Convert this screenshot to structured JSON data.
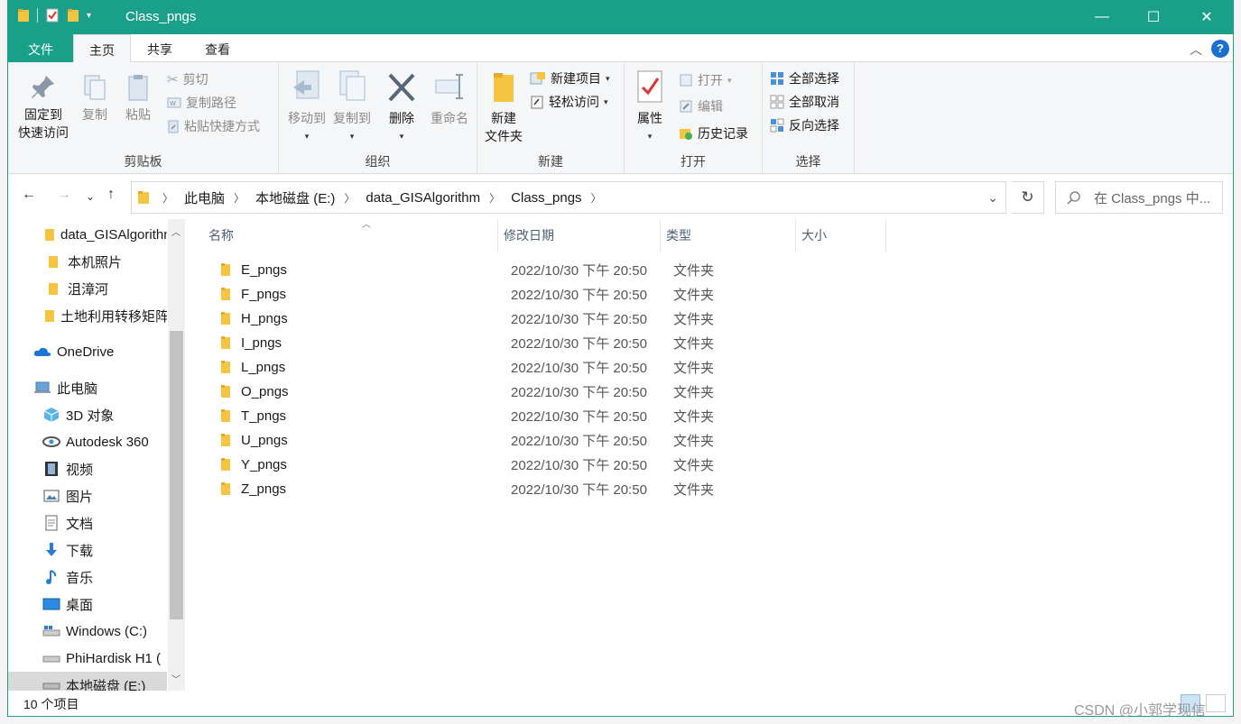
{
  "window": {
    "title": "Class_pngs",
    "minimize": "—",
    "maximize": "☐",
    "close": "✕"
  },
  "tabs": [
    {
      "label": "文件"
    },
    {
      "label": "主页"
    },
    {
      "label": "共享"
    },
    {
      "label": "查看"
    }
  ],
  "ribbon": {
    "clipboard": {
      "label": "剪贴板",
      "pin": "固定到",
      "pin2": "快速访问",
      "copy": "复制",
      "paste": "粘贴",
      "cut": "剪切",
      "copy_path": "复制路径",
      "paste_shortcut": "粘贴快捷方式"
    },
    "organize": {
      "label": "组织",
      "move_to": "移动到",
      "copy_to": "复制到",
      "delete": "删除",
      "rename": "重命名"
    },
    "new": {
      "label": "新建",
      "new_folder": "新建",
      "new_folder2": "文件夹",
      "new_item": "新建项目",
      "easy_access": "轻松访问"
    },
    "open": {
      "label": "打开",
      "properties": "属性",
      "open": "打开",
      "edit": "编辑",
      "history": "历史记录"
    },
    "select": {
      "label": "选择",
      "select_all": "全部选择",
      "select_none": "全部取消",
      "invert": "反向选择"
    }
  },
  "address": {
    "crumbs": [
      "此电脑",
      "本地磁盘 (E:)",
      "data_GISAlgorithm",
      "Class_pngs"
    ],
    "search_placeholder": "在 Class_pngs 中..."
  },
  "nav": [
    {
      "label": "data_GISAlgorithm",
      "icon": "folder-icon"
    },
    {
      "label": "本机照片",
      "icon": "folder-icon"
    },
    {
      "label": "沮漳河",
      "icon": "folder-icon"
    },
    {
      "label": "土地利用转移矩阵",
      "icon": "folder-icon"
    },
    {
      "label": "OneDrive",
      "icon": "cloud-icon"
    },
    {
      "label": "此电脑",
      "icon": "computer-icon"
    },
    {
      "label": "3D 对象",
      "icon": "cube-icon"
    },
    {
      "label": "Autodesk 360",
      "icon": "autodesk-icon"
    },
    {
      "label": "视频",
      "icon": "video-icon"
    },
    {
      "label": "图片",
      "icon": "picture-icon"
    },
    {
      "label": "文档",
      "icon": "document-icon"
    },
    {
      "label": "下载",
      "icon": "download-icon"
    },
    {
      "label": "音乐",
      "icon": "music-icon"
    },
    {
      "label": "桌面",
      "icon": "desktop-icon"
    },
    {
      "label": "Windows (C:)",
      "icon": "drive-icon"
    },
    {
      "label": "PhiHardisk H1 (",
      "icon": "drive-icon"
    },
    {
      "label": "本地磁盘 (E:)",
      "icon": "drive-icon"
    }
  ],
  "columns": {
    "name": "名称",
    "date": "修改日期",
    "type": "类型",
    "size": "大小"
  },
  "files": [
    {
      "name": "E_pngs",
      "date": "2022/10/30 下午 20:50",
      "type": "文件夹"
    },
    {
      "name": "F_pngs",
      "date": "2022/10/30 下午 20:50",
      "type": "文件夹"
    },
    {
      "name": "H_pngs",
      "date": "2022/10/30 下午 20:50",
      "type": "文件夹"
    },
    {
      "name": "I_pngs",
      "date": "2022/10/30 下午 20:50",
      "type": "文件夹"
    },
    {
      "name": "L_pngs",
      "date": "2022/10/30 下午 20:50",
      "type": "文件夹"
    },
    {
      "name": "O_pngs",
      "date": "2022/10/30 下午 20:50",
      "type": "文件夹"
    },
    {
      "name": "T_pngs",
      "date": "2022/10/30 下午 20:50",
      "type": "文件夹"
    },
    {
      "name": "U_pngs",
      "date": "2022/10/30 下午 20:50",
      "type": "文件夹"
    },
    {
      "name": "Y_pngs",
      "date": "2022/10/30 下午 20:50",
      "type": "文件夹"
    },
    {
      "name": "Z_pngs",
      "date": "2022/10/30 下午 20:50",
      "type": "文件夹"
    }
  ],
  "status": {
    "count": "10 个项目"
  },
  "watermark": "CSDN @小郭学现信",
  "colors": {
    "accent": "#1aa08a",
    "folder": "#f5c542",
    "help": "#1a6fd0"
  }
}
